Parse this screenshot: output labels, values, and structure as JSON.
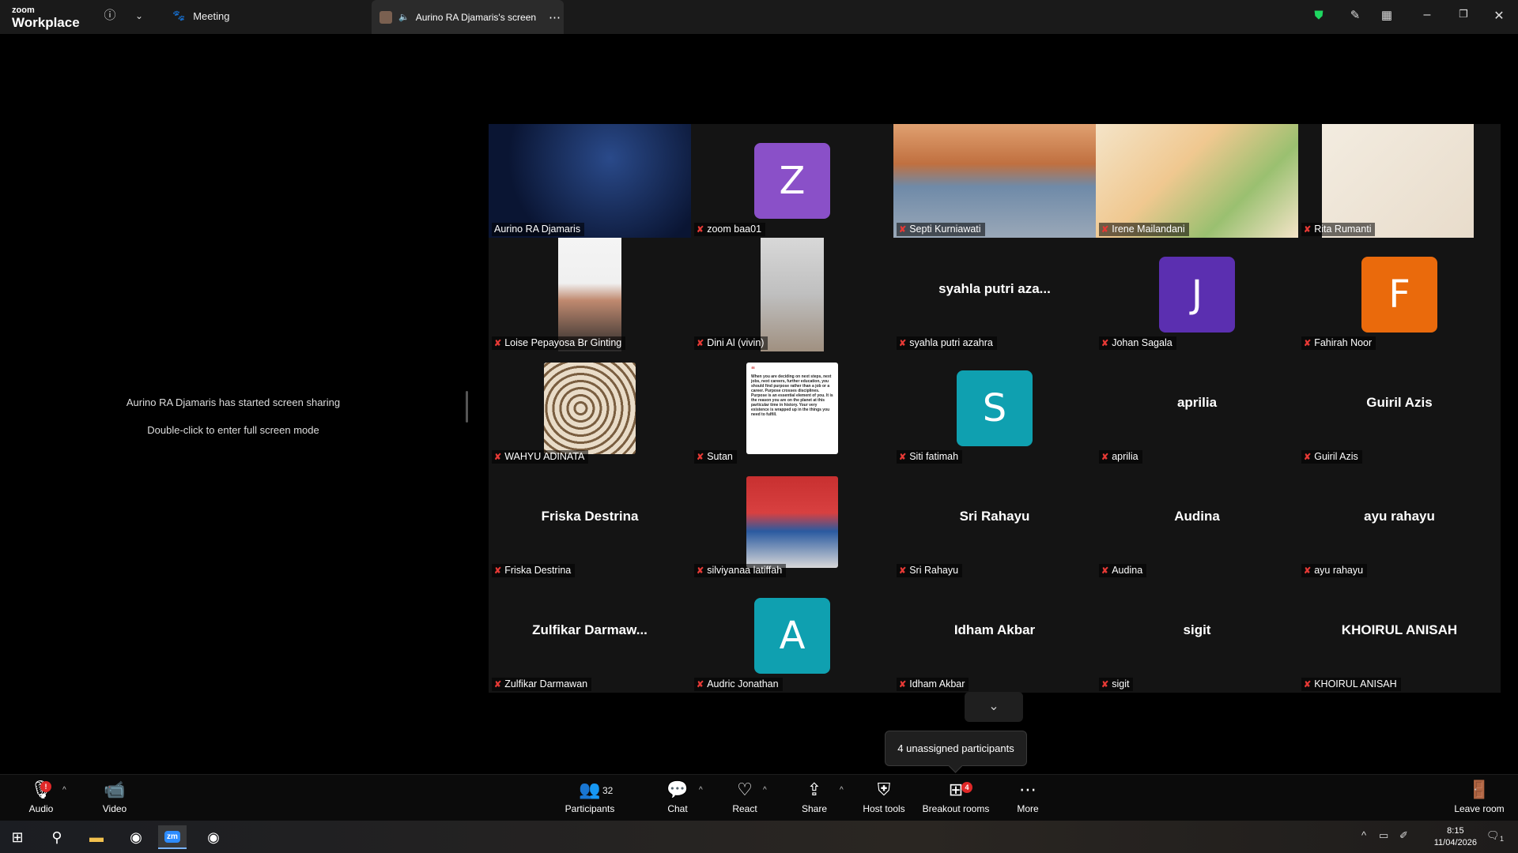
{
  "titlebar": {
    "brand_small": "zoom",
    "brand_big": "Workplace",
    "meeting_label": "Meeting",
    "screen_tab_label": "Aurino RA Djamaris's screen"
  },
  "share": {
    "started_text": "Aurino RA Djamaris has started screen sharing",
    "fullscreen_hint": "Double-click to enter full screen mode"
  },
  "participants": [
    {
      "name": "Aurino RA Djamaris",
      "big": "",
      "avatar": "",
      "color": "",
      "media": "video",
      "active": true
    },
    {
      "name": "zoom baa01",
      "big": "",
      "avatar": "Z",
      "color": "#8a50c8",
      "media": "avatar"
    },
    {
      "name": "Septi Kurniawati",
      "big": "",
      "avatar": "",
      "color": "",
      "media": "video"
    },
    {
      "name": "Irene Mailandani",
      "big": "",
      "avatar": "",
      "color": "",
      "media": "video"
    },
    {
      "name": "Rita Rumanti",
      "big": "",
      "avatar": "",
      "color": "",
      "media": "video"
    },
    {
      "name": "Loise Pepayosa Br Ginting",
      "big": "",
      "avatar": "",
      "color": "",
      "media": "video"
    },
    {
      "name": "Dini Al (vivin)",
      "big": "",
      "avatar": "",
      "color": "",
      "media": "video"
    },
    {
      "name": "syahla putri azahra",
      "big": "syahla putri aza...",
      "avatar": "",
      "color": "",
      "media": "name"
    },
    {
      "name": "Johan Sagala",
      "big": "",
      "avatar": "J",
      "color": "#5b2fb0",
      "media": "avatar"
    },
    {
      "name": "Fahirah Noor",
      "big": "",
      "avatar": "F",
      "color": "#ea6a0c",
      "media": "avatar"
    },
    {
      "name": "WAHYU ADINATA",
      "big": "",
      "avatar": "",
      "color": "",
      "media": "photo"
    },
    {
      "name": "Sutan",
      "big": "",
      "avatar": "",
      "color": "",
      "media": "quote"
    },
    {
      "name": "Siti fatimah",
      "big": "",
      "avatar": "S",
      "color": "#0fa0b0",
      "media": "avatar"
    },
    {
      "name": "aprilia",
      "big": "aprilia",
      "avatar": "",
      "color": "",
      "media": "name"
    },
    {
      "name": "Guiril Azis",
      "big": "Guiril Azis",
      "avatar": "",
      "color": "",
      "media": "name"
    },
    {
      "name": "Friska Destrina",
      "big": "Friska Destrina",
      "avatar": "",
      "color": "",
      "media": "name"
    },
    {
      "name": "silviyanaa latiffah",
      "big": "",
      "avatar": "",
      "color": "",
      "media": "photo2"
    },
    {
      "name": "Sri Rahayu",
      "big": "Sri Rahayu",
      "avatar": "",
      "color": "",
      "media": "name"
    },
    {
      "name": "Audina",
      "big": "Audina",
      "avatar": "",
      "color": "",
      "media": "name"
    },
    {
      "name": "ayu rahayu",
      "big": "ayu rahayu",
      "avatar": "",
      "color": "",
      "media": "name"
    },
    {
      "name": "Zulfikar Darmawan",
      "big": "Zulfikar  Darmaw...",
      "avatar": "",
      "color": "",
      "media": "name"
    },
    {
      "name": "Audric Jonathan",
      "big": "",
      "avatar": "A",
      "color": "#0fa0b0",
      "media": "avatar"
    },
    {
      "name": "Idham Akbar",
      "big": "Idham Akbar",
      "avatar": "",
      "color": "",
      "media": "name"
    },
    {
      "name": "sigit",
      "big": "sigit",
      "avatar": "",
      "color": "",
      "media": "name"
    },
    {
      "name": "KHOIRUL ANISAH",
      "big": "KHOIRUL ANISAH",
      "avatar": "",
      "color": "",
      "media": "name"
    }
  ],
  "quote_text": "When you are deciding on next steps, next jobs, next careers, further education, you should find purpose rather than a job or a career. Purpose crosses disciplines. Purpose is an essential element of you. It is the reason you are on the planet at this particular time in history. Your very existence is wrapped up in the things you need to fulfill.",
  "tooltip": "4 unassigned participants",
  "toolbar": {
    "audio": "Audio",
    "video": "Video",
    "participants": "Participants",
    "participants_count": "32",
    "chat": "Chat",
    "react": "React",
    "share": "Share",
    "host_tools": "Host tools",
    "breakout_rooms": "Breakout rooms",
    "breakout_badge": "4",
    "more": "More",
    "leave_room": "Leave room"
  },
  "taskbar": {
    "time": "8:15",
    "date": "11/04/2026",
    "notifications": "1"
  },
  "colors": {
    "active_speaker": "#1ed760",
    "mic_off": "#e53935",
    "leave": "#e02828"
  }
}
